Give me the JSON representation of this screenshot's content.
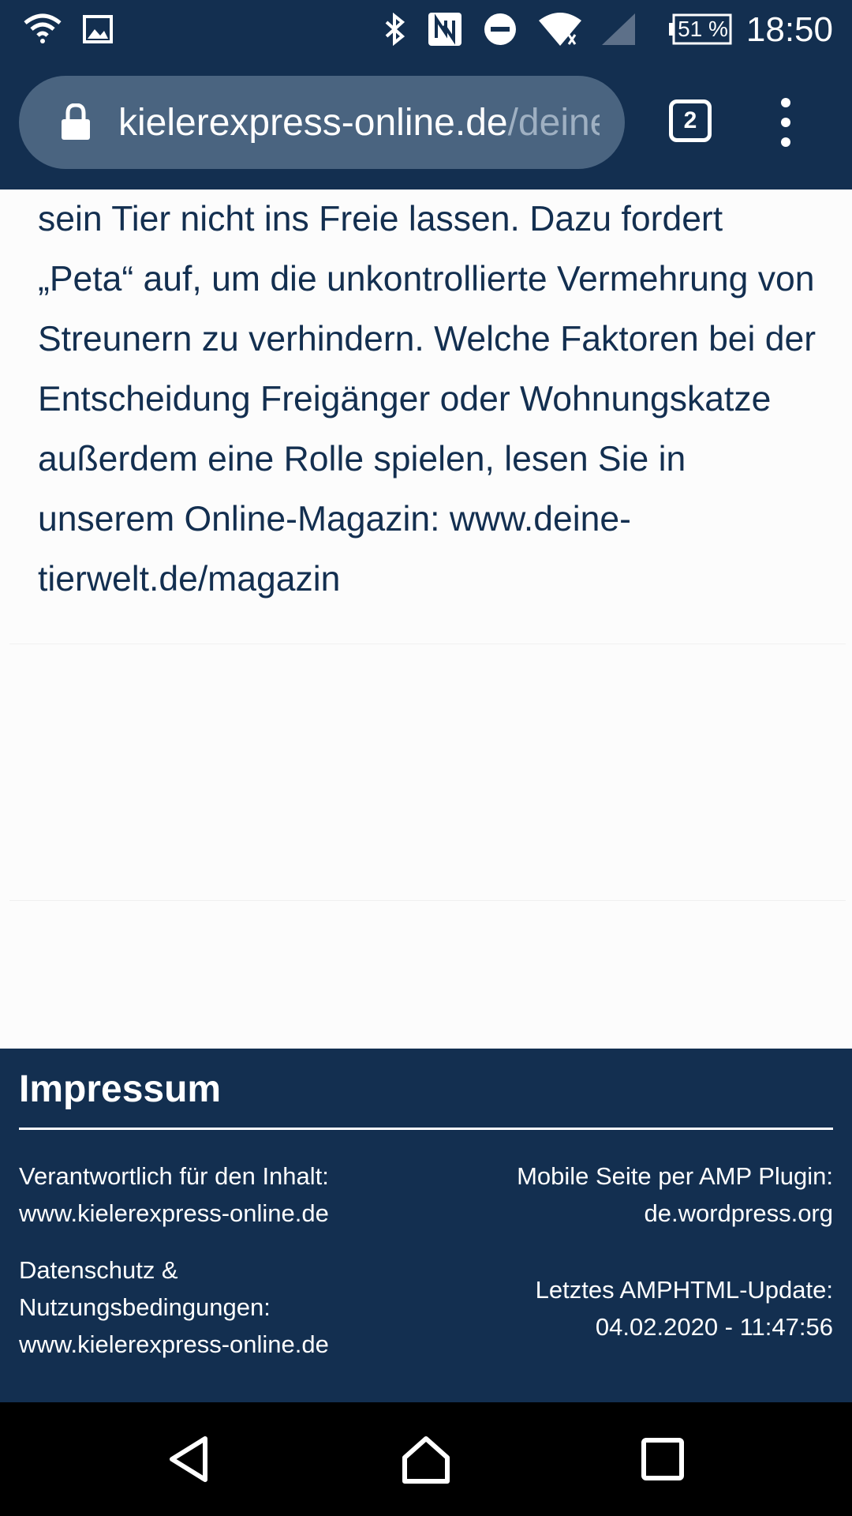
{
  "status_bar": {
    "battery": "51 %",
    "time": "18:50",
    "icons": [
      "wifi-icon",
      "image-icon",
      "bluetooth-icon",
      "nfc-icon",
      "do-not-disturb-icon",
      "wifi-signal-icon",
      "cell-signal-icon",
      "battery-icon"
    ]
  },
  "browser": {
    "url_host": "kielerexpress-online.de",
    "url_path": "/deine",
    "tab_count": "2"
  },
  "article": {
    "text": "sein Tier nicht ins Freie lassen. Dazu fordert „Peta“ auf, um die unkontrollierte Vermehrung von Streunern zu verhindern. Welche Faktoren bei der Entscheidung Freigänger oder Wohnungskatze außerdem eine Rolle spielen, lesen Sie in unserem Online-Magazin: www.deine-tierwelt.de/magazin"
  },
  "footer": {
    "title": "Impressum",
    "responsible_label": "Verantwortlich für den Inhalt:",
    "responsible_url": "www.kielerexpress-online.de",
    "privacy_label_1": "Datenschutz &",
    "privacy_label_2": "Nutzungsbedingungen:",
    "privacy_url": "www.kielerexpress-online.de",
    "amp_label": "Mobile Seite per AMP Plugin:",
    "amp_url": "de.wordpress.org",
    "update_label": "Letztes AMPHTML-Update:",
    "update_value": "04.02.2020 - 11:47:56"
  },
  "nav": [
    "back-icon",
    "home-icon",
    "recents-icon"
  ],
  "colors": {
    "primary": "#132f50",
    "urlbar": "#4a6480",
    "background": "#fcfcfc"
  }
}
